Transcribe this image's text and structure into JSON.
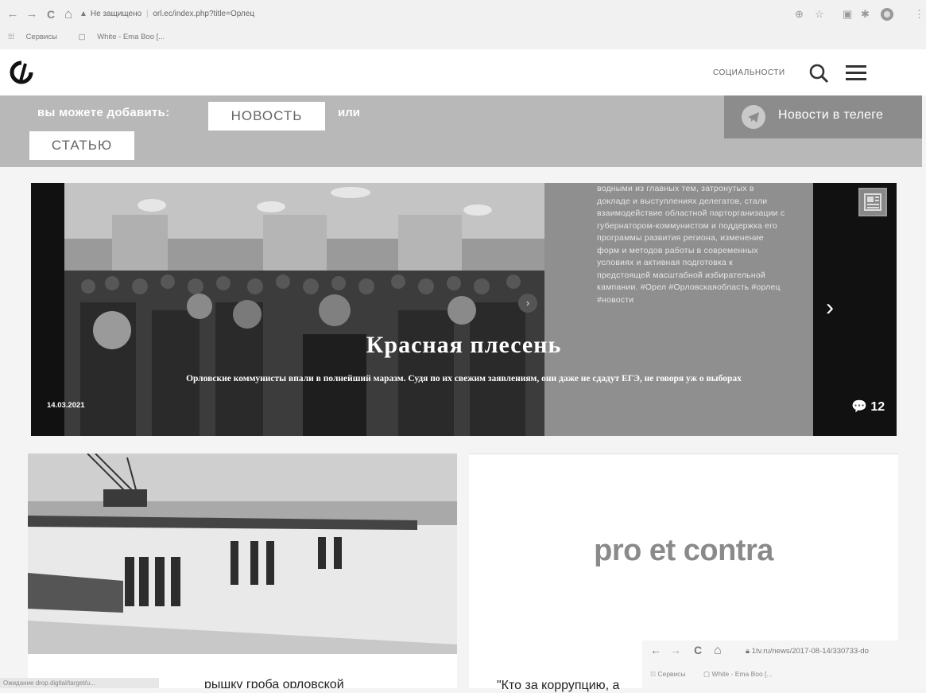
{
  "browser": {
    "nav": {
      "back": "←",
      "forward": "→",
      "reload": "C",
      "home": "⌂"
    },
    "omnibox": {
      "security": "Не защищено",
      "url": "orl.ec/index.php?title=Орлец"
    },
    "bookmarks": {
      "apps": "Сервисы",
      "item1": "White - Ema Boo [..."
    },
    "icons": [
      "zoom-icon",
      "star-icon",
      "extension-icon",
      "puzzle-icon",
      "profile-icon",
      "menu-icon"
    ],
    "status": "Ожидание drop.digital/target/u..."
  },
  "header": {
    "social_link": "СОЦИАЛЬНОСТИ"
  },
  "add_bar": {
    "prompt": "вы можете добавить:",
    "news_button": "НОВОСТЬ",
    "or": "или",
    "article_button": "СТАТЬЮ",
    "telegram_label": "Новости в телеге"
  },
  "hero": {
    "description": "водными из главных тем, затронутых в докладе и выступлениях делегатов, стали взаимодействие областной парторганизации с губернатором-коммунистом и поддержка его программы развития региона, изменение форм и методов работы в современных условиях и активная подготовка к предстоящей масштабной избирательной кампании. #Орел #Орловскаяобласть #орлец #новости",
    "title": "Красная плесень",
    "summary": "Орловские коммунисты впали в полнейший маразм. Судя по их свежим заявлениям, они даже не сдадут ЕГЭ, не говоря уж о выборах",
    "date": "14.03.2021",
    "comments": "12"
  },
  "cards": [
    {
      "title": "рышку гроба орловской"
    },
    {
      "logo_text": "pro et contra",
      "title": "\"Кто за коррупцию, а"
    }
  ],
  "overlay_browser": {
    "url": "1tv.ru/news/2017-08-14/330733-do",
    "bookmarks_apps": "Сервисы",
    "bookmarks_item": "White - Ema Boo [..."
  }
}
